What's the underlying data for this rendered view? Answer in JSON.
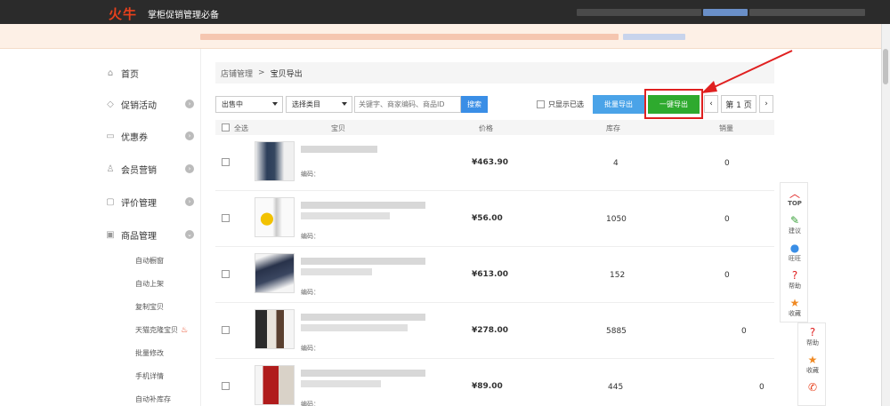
{
  "header": {
    "logo": "火牛",
    "title": "掌柜促销管理必备",
    "bg_color": "#2b2b2b",
    "logo_color": "#e8401c"
  },
  "sidebar": {
    "items": [
      {
        "label": "首页",
        "icon": "home-icon"
      },
      {
        "label": "促销活动",
        "icon": "tag-icon"
      },
      {
        "label": "优惠券",
        "icon": "coupon-icon"
      },
      {
        "label": "会员营销",
        "icon": "user-icon"
      },
      {
        "label": "评价管理",
        "icon": "comment-icon"
      },
      {
        "label": "商品管理",
        "icon": "goods-icon"
      }
    ],
    "sub_items": [
      "自动橱窗",
      "自动上架",
      "复制宝贝",
      "天猫克隆宝贝",
      "批量修改",
      "手机详情",
      "自动补库存"
    ]
  },
  "breadcrumb": {
    "parent": "店铺管理",
    "separator": ">",
    "current": "宝贝导出"
  },
  "toolbar": {
    "status_select": "出售中",
    "category_select": "选择类目",
    "search_placeholder": "关键字、商家编码、商品ID",
    "search_button": "搜索",
    "only_show_selected": "只显示已选",
    "batch_export": "批量导出",
    "one_click_export": "一键导出",
    "page_label": "第 1 页",
    "prev": "‹",
    "next": "›"
  },
  "table": {
    "headers": {
      "select_all": "全选",
      "item": "宝贝",
      "price": "价格",
      "stock": "库存",
      "sales": "销量"
    },
    "code_label": "编码：",
    "rows": [
      {
        "price": "¥463.90",
        "stock": "4",
        "sales": "0"
      },
      {
        "price": "¥56.00",
        "stock": "1050",
        "sales": "0"
      },
      {
        "price": "¥613.00",
        "stock": "152",
        "sales": "0"
      },
      {
        "price": "¥278.00",
        "stock": "5885",
        "sales": "0"
      },
      {
        "price": "¥89.00",
        "stock": "445",
        "sales": "0"
      }
    ]
  },
  "float_bar": {
    "items": [
      {
        "label": "TOP",
        "icon": "arrow-up-icon"
      },
      {
        "label": "建议",
        "icon": "pencil-icon"
      },
      {
        "label": "旺旺",
        "icon": "chat-icon"
      },
      {
        "label": "帮助",
        "icon": "help-icon"
      },
      {
        "label": "收藏",
        "icon": "star-icon"
      }
    ],
    "items2": [
      {
        "label": "帮助",
        "icon": "help-icon"
      },
      {
        "label": "收藏",
        "icon": "star-icon"
      },
      {
        "label": "",
        "icon": "phone-icon"
      }
    ]
  },
  "colors": {
    "accent_blue": "#3a8ee6",
    "export_green": "#2eaa2e",
    "highlight_red": "#e02020",
    "notice_bg": "#fdf0e6"
  }
}
